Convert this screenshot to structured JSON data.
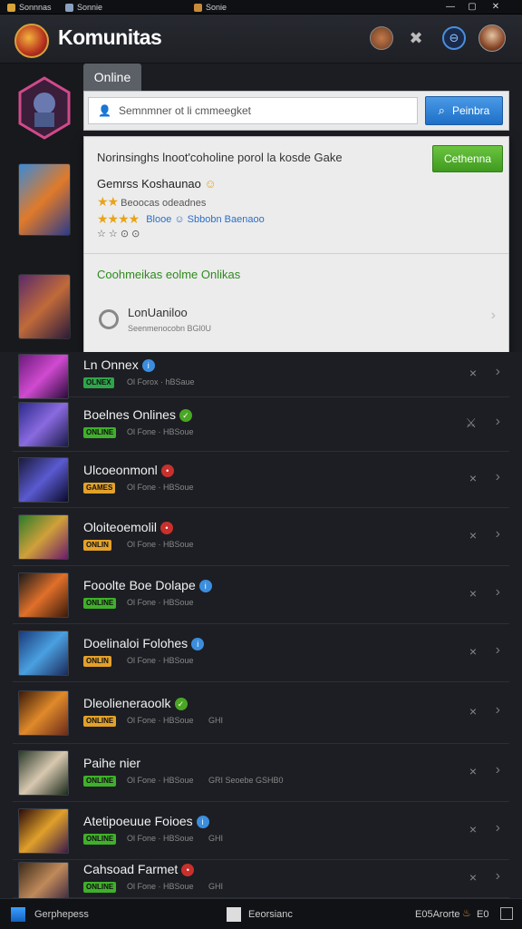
{
  "titlebar": {
    "tabs": [
      {
        "label": "Sonnnas",
        "icon": "game-icon",
        "color": "#d9a43b"
      },
      {
        "label": "Sonnie",
        "icon": "grid-icon",
        "color": "#8aa0c0"
      },
      {
        "label": "Sonie",
        "icon": "game-icon",
        "color": "#c98a3a"
      }
    ],
    "controls": {
      "minimize": "—",
      "maximize": "▢",
      "close": "✕"
    }
  },
  "header": {
    "title": "Komunitas",
    "icons": [
      "avatar-icon",
      "swords-icon",
      "settings-icon",
      "profile-avatar-icon"
    ]
  },
  "tooltip": {
    "label": "Online"
  },
  "search": {
    "placeholder": "Semnmner ot li cmmeegket",
    "button_label": "Peinbra"
  },
  "panel": {
    "heading": "Norinsinghs lnoot'coholine porol la kosde Gake",
    "button_label": "Cethenna",
    "game_name": "Gemrss Koshaunao",
    "rating_text": "Beoocas odeadnes",
    "stars_count": 4,
    "stars_link": "Blooe ☺ Sbbobn Baenaoo",
    "misc_row": "☆ ☆ ⊙ ⊙",
    "section_title": "Coohmeikas eolme Onlikas",
    "item_title": "LonUaniloo",
    "item_sub": "Seenmenocobn BGl0U"
  },
  "list": {
    "rows": [
      {
        "title": "Ln Onnex",
        "badge": "blue",
        "tag": "OLNEX",
        "tag_color": "#2fa54a",
        "sub": "Ol Forox · hBSaue",
        "extra": "",
        "x": "×"
      },
      {
        "title": "Boelnes Onlines",
        "badge": "green",
        "tag": "ONLINE",
        "tag_color": "#3fb02a",
        "sub": "Ol Fone · HBSoue",
        "extra": "",
        "x": "⚔"
      },
      {
        "title": "Ulcoeonmonl",
        "badge": "red",
        "tag": "GAMES",
        "tag_color": "#e3a12a",
        "sub": "Ol Fone · HBSoue",
        "extra": "",
        "x": "×"
      },
      {
        "title": "Oloiteoemolil",
        "badge": "red",
        "tag": "ONLIN",
        "tag_color": "#e3a12a",
        "sub": "Ol Fone · HBSoue",
        "extra": "",
        "x": "×"
      },
      {
        "title": "Fooolte Boe Dolape",
        "badge": "blue",
        "tag": "ONLINE",
        "tag_color": "#3fb02a",
        "sub": "Ol Fone · HBSoue",
        "extra": "",
        "x": "×"
      },
      {
        "title": "Doelinaloi Folohes",
        "badge": "blue",
        "tag": "ONLIN",
        "tag_color": "#e3a12a",
        "sub": "Ol Fone · HBSoue",
        "extra": "",
        "x": "×"
      },
      {
        "title": "Dleolieneraoolk",
        "badge": "green",
        "tag": "ONLINE",
        "tag_color": "#e3a12a",
        "sub": "Ol Fone · HBSoue",
        "extra": "GHI",
        "x": "×"
      },
      {
        "title": "Paihe nier",
        "badge": "",
        "tag": "ONLINE",
        "tag_color": "#3fb02a",
        "sub": "Ol Fone · HBSoue",
        "extra": "GRI Seoebe GSHB0",
        "x": "×"
      },
      {
        "title": "Atetipoeuue Foioes",
        "badge": "blue",
        "tag": "ONLINE",
        "tag_color": "#3fb02a",
        "sub": "Ol Fone · HBSoue",
        "extra": "GHI",
        "x": "×"
      },
      {
        "title": "Cahsoad Farmet",
        "badge": "red",
        "tag": "ONLINE",
        "tag_color": "#3fb02a",
        "sub": "Ol Fone · HBSoue",
        "extra": "GHI",
        "x": "×"
      }
    ]
  },
  "taskbar": {
    "start_label": "Gerphepess",
    "app_label": "Eeorsianc",
    "tray_label": "E05Arorte",
    "tray_time": "E0"
  },
  "colors": {
    "accent_blue": "#1e6fc7",
    "accent_green": "#3f9a1f",
    "badge_red": "#c9302c",
    "badge_green": "#4aa624",
    "badge_blue": "#3b8ede"
  }
}
